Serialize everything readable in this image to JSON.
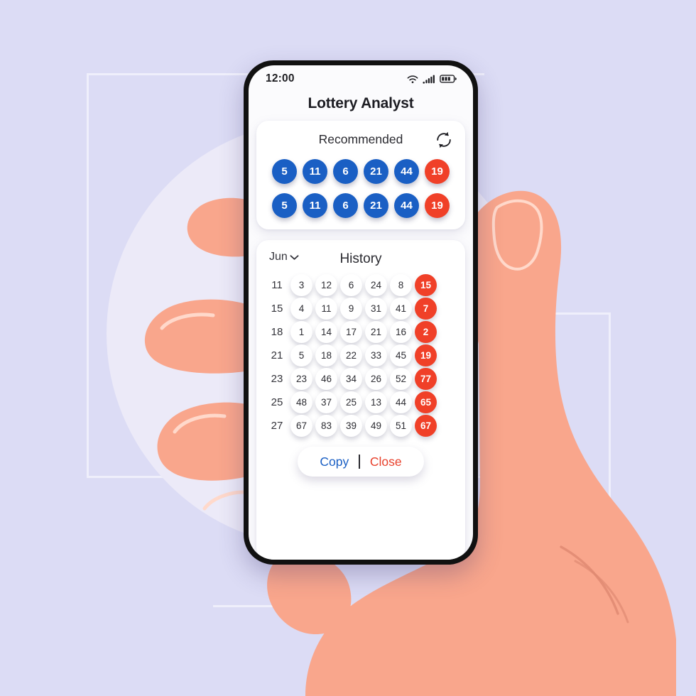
{
  "status_bar": {
    "time": "12:00",
    "icons": [
      "wifi-icon",
      "signal-icon",
      "battery-icon"
    ]
  },
  "app": {
    "title": "Lottery Analyst"
  },
  "recommended": {
    "title": "Recommended",
    "refresh_icon": "refresh-icon",
    "rows": [
      {
        "numbers": [
          5,
          11,
          6,
          21,
          44
        ],
        "bonus": 19
      },
      {
        "numbers": [
          5,
          11,
          6,
          21,
          44
        ],
        "bonus": 19
      }
    ]
  },
  "history": {
    "title": "History",
    "month": "Jun",
    "month_chevron_icon": "chevron-down-icon",
    "rows": [
      {
        "day": 11,
        "numbers": [
          3,
          12,
          6,
          24,
          8
        ],
        "bonus": 15
      },
      {
        "day": 15,
        "numbers": [
          4,
          11,
          9,
          31,
          41
        ],
        "bonus": 7
      },
      {
        "day": 18,
        "numbers": [
          1,
          14,
          17,
          21,
          16
        ],
        "bonus": 2
      },
      {
        "day": 21,
        "numbers": [
          5,
          18,
          22,
          33,
          45
        ],
        "bonus": 19
      },
      {
        "day": 23,
        "numbers": [
          23,
          46,
          34,
          26,
          52
        ],
        "bonus": 77
      },
      {
        "day": 25,
        "numbers": [
          48,
          37,
          25,
          13,
          44
        ],
        "bonus": 65
      },
      {
        "day": 27,
        "numbers": [
          67,
          83,
          39,
          49,
          51
        ],
        "bonus": 67
      }
    ]
  },
  "actions": {
    "copy_label": "Copy",
    "divider": "|",
    "close_label": "Close"
  },
  "colors": {
    "background": "#dcdcf5",
    "ball_blue": "#1a5fc4",
    "ball_red": "#f04028",
    "copy_blue": "#1a5fc4",
    "close_red": "#e8412c",
    "skin": "#f9a68c",
    "circle": "#eceaf8"
  }
}
